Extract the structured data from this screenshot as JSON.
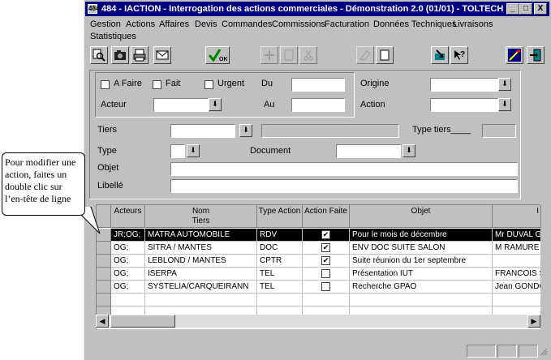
{
  "window": {
    "title": "484 - IACTION - Interrogation des actions commerciales - Démonstration 2.0 (01/01) - TOLTECH",
    "app_icon_text": "484",
    "minimize": "_",
    "maximize": "□",
    "close": "X"
  },
  "menu": [
    "Gestion",
    "Actions",
    "Affaires",
    "Devis",
    "Commandes",
    "Commissions",
    "Facturation",
    "Données Techniques",
    "Livraisons",
    "Statistiques"
  ],
  "filters": {
    "afaire": "A Faire",
    "fait": "Fait",
    "urgent": "Urgent",
    "du": "Du",
    "au": "Au",
    "acteur": "Acteur",
    "origine": "Origine",
    "action": "Action",
    "tiers": "Tiers",
    "type_tiers": "Type tiers____",
    "type": "Type",
    "document": "Document",
    "objet": "Objet",
    "libelle": "Libellé",
    "dropdown_arrow": "⬇"
  },
  "grid": {
    "headers": {
      "acteurs": "Acteurs",
      "nom": "Nom",
      "tiers": "Tiers",
      "type_action": "Type Action",
      "action_faite": "Action Faite",
      "objet": "Objet",
      "last": "I"
    },
    "rows": [
      {
        "acteurs": "JR;OG;",
        "nom": "MATRA AUTOMOBILE",
        "type": "RDV",
        "faite": true,
        "objet": "Pour le mois de décembre",
        "contact": "Mr DUVAL G"
      },
      {
        "acteurs": "OG;",
        "nom": "SITRA / MANTES",
        "type": "DOC",
        "faite": true,
        "objet": "ENV DOC SUITE SALON",
        "contact": "M RAMURE"
      },
      {
        "acteurs": "OG;",
        "nom": "LEBLOND / MANTES",
        "type": "CPTR",
        "faite": true,
        "objet": "Suite réunion du 1er septembre",
        "contact": ""
      },
      {
        "acteurs": "OG;",
        "nom": "ISERPA",
        "type": "TEL",
        "faite": false,
        "objet": "Présentation IUT",
        "contact": "FRANCOIS S"
      },
      {
        "acteurs": "OG;",
        "nom": "SYSTELIA/CARQUEIRANN",
        "type": "TEL",
        "faite": false,
        "objet": "Recherche GPAO",
        "contact": "Jean GONDO"
      }
    ],
    "check_mark": "✔",
    "scroll_left": "◀",
    "scroll_right": "▶"
  },
  "callout": {
    "text": "Pour modifier une action, faites un double clic sur l’en-tête de ligne"
  }
}
